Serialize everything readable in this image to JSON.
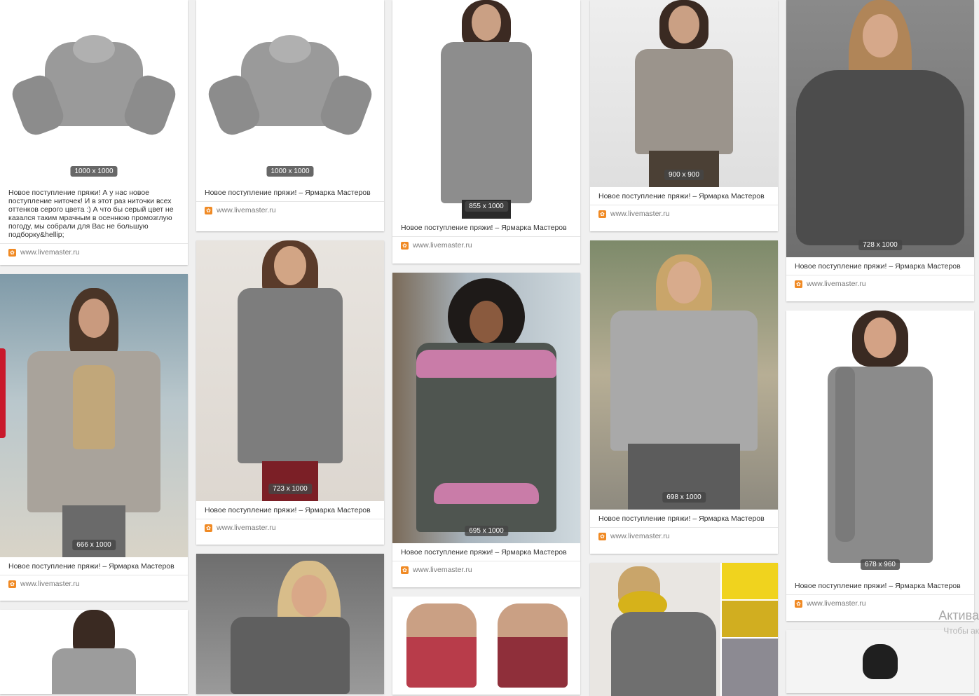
{
  "caption_short": "Новое поступление пряжи! – Ярмарка Мастеров",
  "caption_long": "Новое поступление пряжи! А у нас новое поступление ниточек! И в этот раз ниточки всех оттенков серого цвета :) А что бы серый цвет не казался таким мрачным в осеннюю промозглую погоду, мы собрали для Вас не большую подборку&hellip;",
  "source": "www.livemaster.ru",
  "watermark": {
    "line1": "Актива",
    "line2": "Чтобы ак"
  },
  "cards": [
    {
      "size": "1000 x 1000"
    },
    {
      "size": "666 x 1000"
    },
    {
      "size": "1000 x 1000"
    },
    {
      "size": "723 x 1000"
    },
    {
      "size": "855 x 1000"
    },
    {
      "size": "695 x 1000"
    },
    {
      "size": "900 x 900"
    },
    {
      "size": "698 x 1000"
    },
    {
      "size": "728 x 1000"
    },
    {
      "size": "678 x 960"
    }
  ],
  "colors": {
    "accent_red": "#c9182b",
    "source_icon": "#f08a24"
  }
}
